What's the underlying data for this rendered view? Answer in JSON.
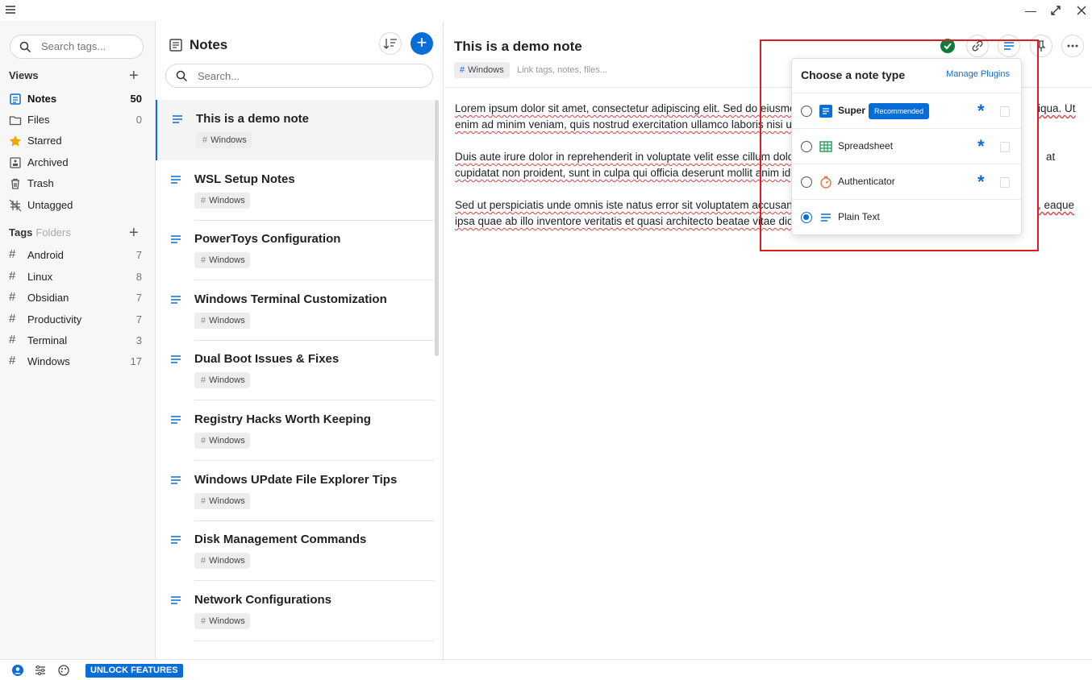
{
  "sidebar": {
    "search_placeholder": "Search tags...",
    "views_heading": "Views",
    "views": [
      {
        "label": "Notes",
        "count": "50",
        "icon": "notes-icon"
      },
      {
        "label": "Files",
        "count": "0",
        "icon": "folder-icon"
      },
      {
        "label": "Starred",
        "count": "",
        "icon": "star-icon"
      },
      {
        "label": "Archived",
        "count": "",
        "icon": "archive-icon"
      },
      {
        "label": "Trash",
        "count": "",
        "icon": "trash-icon"
      },
      {
        "label": "Untagged",
        "count": "",
        "icon": "untagged-icon"
      }
    ],
    "tags_heading": "Tags",
    "folders_label": "Folders",
    "tags": [
      {
        "label": "Android",
        "count": "7"
      },
      {
        "label": "Linux",
        "count": "8"
      },
      {
        "label": "Obsidian",
        "count": "7"
      },
      {
        "label": "Productivity",
        "count": "7"
      },
      {
        "label": "Terminal",
        "count": "3"
      },
      {
        "label": "Windows",
        "count": "17"
      }
    ]
  },
  "notes_list": {
    "title": "Notes",
    "search_placeholder": "Search...",
    "notes": [
      {
        "title": "This is a demo note",
        "tag": "Windows"
      },
      {
        "title": "WSL Setup Notes",
        "tag": "Windows"
      },
      {
        "title": "PowerToys Configuration",
        "tag": "Windows"
      },
      {
        "title": "Windows Terminal Customization",
        "tag": "Windows"
      },
      {
        "title": "Dual Boot Issues & Fixes",
        "tag": "Windows"
      },
      {
        "title": "Registry Hacks Worth Keeping",
        "tag": "Windows"
      },
      {
        "title": "Windows UPdate File Explorer Tips",
        "tag": "Windows"
      },
      {
        "title": "Disk Management Commands",
        "tag": "Windows"
      },
      {
        "title": "Network Configurations",
        "tag": "Windows"
      }
    ]
  },
  "editor": {
    "title": "This is a demo note",
    "tag": "Windows",
    "link_placeholder": "Link tags, notes, files...",
    "paragraphs": [
      "Lorem ipsum dolor sit amet, consectetur adipiscing elit. Sed do eiusmo",
      "enim ad minim veniam, quis nostrud exercitation ullamco laboris nisi ut",
      "Duis aute irure dolor in reprehenderit in voluptate velit esse cillum dolo",
      "cupidatat non proident, sunt in culpa qui officia deserunt mollit anim id",
      "Sed ut perspiciatis unde omnis iste natus error sit voluptatem accusant",
      "ipsa quae ab illo inventore veritatis et quasi architecto beatae vitae dict"
    ],
    "paragraph_tails": [
      "iqua. Ut",
      "at",
      ", eaque"
    ]
  },
  "note_type_popup": {
    "heading": "Choose a note type",
    "manage_label": "Manage Plugins",
    "options": [
      {
        "label": "Super",
        "badge": "Recommended",
        "selected": false
      },
      {
        "label": "Spreadsheet",
        "badge": "",
        "selected": false
      },
      {
        "label": "Authenticator",
        "badge": "",
        "selected": false
      },
      {
        "label": "Plain Text",
        "badge": "",
        "selected": true
      }
    ]
  },
  "footer": {
    "unlock_label": "UNLOCK FEATURES"
  },
  "colors": {
    "accent": "#086dd6",
    "highlight_box": "#e01b22",
    "saved": "#0f7b3a"
  }
}
